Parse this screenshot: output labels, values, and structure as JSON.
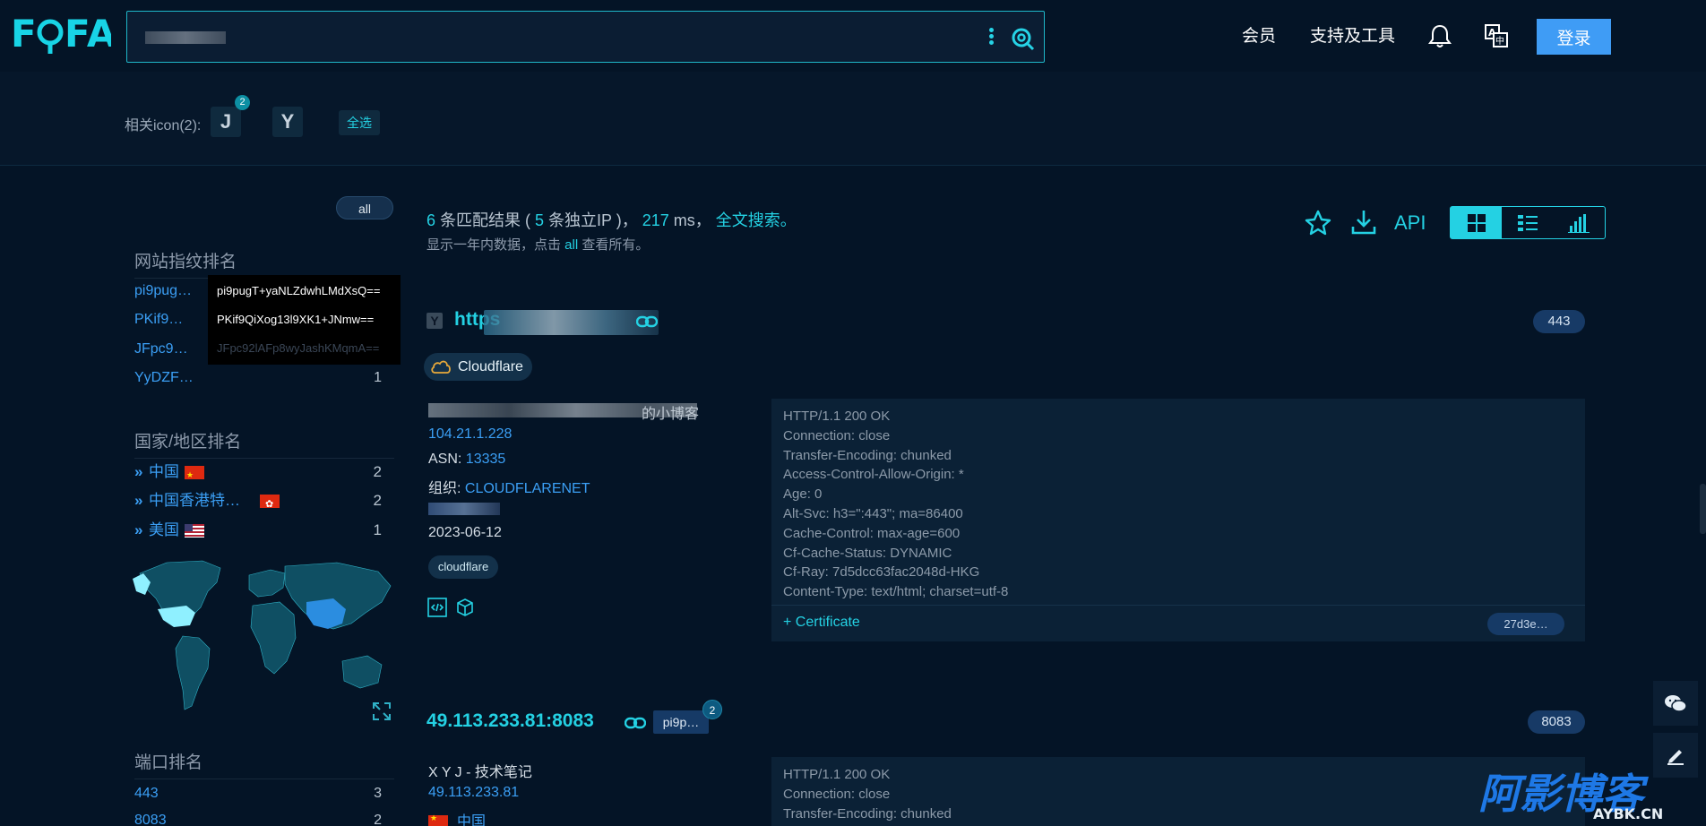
{
  "header": {
    "logo": "FOFA",
    "search_value": "",
    "nav_member": "会员",
    "nav_tools": "支持及工具",
    "login": "登录"
  },
  "icon_bar": {
    "label": "相关icon(2):",
    "icons": [
      {
        "glyph": "J",
        "badge": "2"
      },
      {
        "glyph": "Y",
        "badge": ""
      }
    ],
    "select_all": "全选"
  },
  "sidebar": {
    "all_pill": "all",
    "fingerprint_title": "网站指纹排名",
    "fingerprints": [
      {
        "label": "pi9pug…",
        "count": ""
      },
      {
        "label": "PKif9…",
        "count": ""
      },
      {
        "label": "JFpc9…",
        "count": "1"
      },
      {
        "label": "YyDZF…",
        "count": "1"
      }
    ],
    "tooltip": [
      "pi9pugT+yaNLZdwhLMdXsQ==",
      "PKif9QiXog13l9XK1+JNmw==",
      "JFpc92lAFp8wyJashKMqmA=="
    ],
    "country_title": "国家/地区排名",
    "countries": [
      {
        "label": "中国",
        "count": "2",
        "flag": "cn"
      },
      {
        "label": "中国香港特…",
        "count": "2",
        "flag": "hk"
      },
      {
        "label": "美国",
        "count": "1",
        "flag": "us"
      }
    ],
    "port_title": "端口排名",
    "ports": [
      {
        "label": "443",
        "count": "3"
      },
      {
        "label": "8083",
        "count": "2"
      }
    ]
  },
  "results": {
    "count": "6",
    "part1": " 条匹配结果 ( ",
    "ip_count": "5",
    "part2": " 条独立IP )， ",
    "ms": "217",
    "part3": " ms， ",
    "full_search": "全文搜索",
    "period": "。",
    "sub_prefix": "显示一年内数据，点击 ",
    "sub_all": "all",
    "sub_suffix": " 查看所有。",
    "api": "API"
  },
  "card1": {
    "title": "https",
    "port": "443",
    "cloud_tag": "Cloudflare",
    "site_title_tail": "的小博客",
    "ip": "104.21.1.228",
    "asn_label": "ASN: ",
    "asn": "13335",
    "org_label": "组织: ",
    "org": "CLOUDFLARENET",
    "date": "2023-06-12",
    "tag": "cloudflare",
    "http_lines": [
      "HTTP/1.1 200 OK",
      "Connection: close",
      "Transfer-Encoding: chunked",
      "Access-Control-Allow-Origin: *",
      "Age: 0",
      "Alt-Svc: h3=\":443\"; ma=86400",
      "Cache-Control: max-age=600",
      "Cf-Cache-Status: DYNAMIC",
      "Cf-Ray: 7d5dcc63fac2048d-HKG",
      "Content-Type: text/html; charset=utf-8"
    ],
    "cert_label": "Certificate",
    "cert_hash": "27d3e…"
  },
  "card2": {
    "title": "49.113.233.81:8083",
    "tag_chip": "pi9p…",
    "tag_badge": "2",
    "port": "8083",
    "site_title": "X Y J - 技术笔记",
    "ip": "49.113.233.81",
    "country": "中国",
    "http_lines": [
      "HTTP/1.1 200 OK",
      "Connection: close",
      "Transfer-Encoding: chunked"
    ]
  },
  "watermark": {
    "text": "阿影博客",
    "sub": "AYBK.CN"
  },
  "colors": {
    "background": "#041426",
    "accent": "#24d1e3",
    "link": "#3b9ff5",
    "login": "#3f9cf5"
  }
}
